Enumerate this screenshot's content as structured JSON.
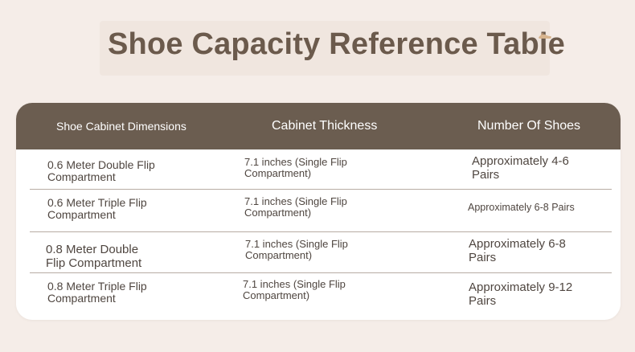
{
  "title": "Shoe Capacity Reference Table",
  "colors": {
    "page_background": "#f5ede8",
    "title_text": "#6b5a4c",
    "header_background": "#6b5d50",
    "header_text": "#ffffff",
    "body_text": "#4f4640",
    "divider": "#b8aca4"
  },
  "icons": {
    "title_decoration": "shoe-icon"
  },
  "table": {
    "headers": [
      "Shoe Cabinet Dimensions",
      "Cabinet Thickness",
      "Number Of Shoes"
    ],
    "rows": [
      [
        "0.6 Meter Double Flip Compartment",
        "7.1 inches (Single Flip Compartment)",
        "Approximately 4-6 Pairs"
      ],
      [
        "0.6 Meter Triple Flip Compartment",
        "7.1 inches (Single Flip Compartment)",
        "Approximately 6-8 Pairs"
      ],
      [
        "0.8 Meter Double Flip Compartment",
        "7.1 inches (Single Flip Compartment)",
        "Approximately 6-8 Pairs"
      ],
      [
        "0.8 Meter Triple Flip Compartment",
        "7.1 inches (Single Flip Compartment)",
        "Approximately 9-12 Pairs"
      ]
    ]
  }
}
